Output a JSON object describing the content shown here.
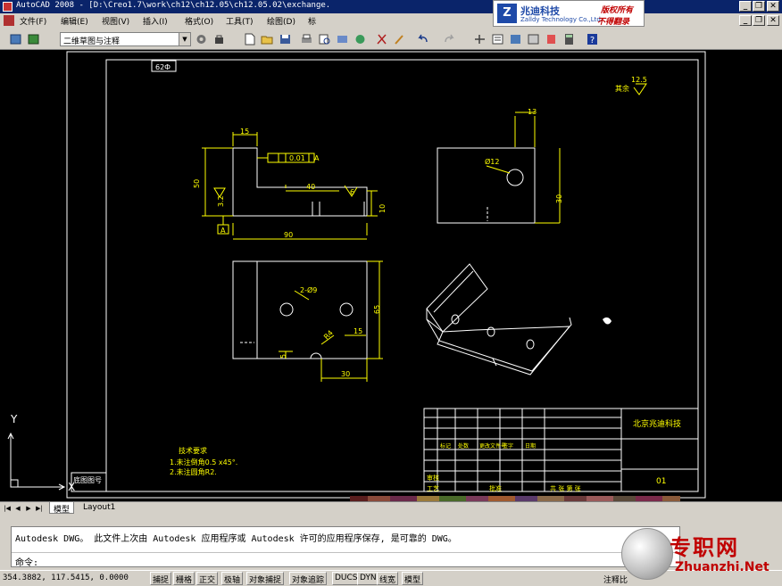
{
  "window": {
    "title": "AutoCAD 2008 - [D:\\Creo1.7\\work\\ch12\\ch12.05\\ch12.05.02\\exchange.",
    "min": "_",
    "restore": "❐",
    "close": "✕",
    "doc_min": "_",
    "doc_restore": "❐",
    "doc_close": "✕"
  },
  "logo": {
    "mark": "Z",
    "company_cn": "兆迪科技",
    "company_en": "Zalldy Technology Co.,Ltd.",
    "copyright_1": "版权所有",
    "copyright_2": "不得翻录"
  },
  "menu": [
    "文件(F)",
    "编辑(E)",
    "视图(V)",
    "插入(I)",
    "格式(O)",
    "工具(T)",
    "绘图(D)",
    "标"
  ],
  "workspace": {
    "value": "二维草图与注释"
  },
  "drawing": {
    "corner_tag": "62Ф",
    "roughness_other": "其余",
    "roughness_other_value": "12.5",
    "dims": {
      "d15": "15",
      "d50": "50",
      "d40": "40",
      "d6": "6",
      "d10": "10",
      "d90": "90",
      "d32": "3.2",
      "datum": "A",
      "tol": "0.01",
      "tol_ref": "A",
      "d13": "13",
      "dia12": "Ø12",
      "d30a": "30",
      "holes": "2-Ø9",
      "d65": "65",
      "r4": "R4",
      "d15b": "15",
      "d5": "5",
      "d30b": "30"
    },
    "tech_title": "技术要求",
    "tech_1": "1.未注倒角0.5 x45°.",
    "tech_2": "2.未注圆角R2.",
    "title_block": {
      "company": "北京兆迪科技",
      "sheet": "01",
      "row_labels": [
        "审核",
        "工艺"
      ],
      "approve": "批准",
      "sheet_info": "共  张 第  张",
      "header_cells": [
        "标记",
        "处数",
        "更改文件号",
        "签字",
        "日期"
      ]
    },
    "ref_label": "底图图号",
    "ucs_x": "X",
    "ucs_y": "Y"
  },
  "tabs": {
    "nav": [
      "|◀",
      "◀",
      "▶",
      "▶|"
    ],
    "items": [
      "模型",
      "Layout1"
    ],
    "active": "模型"
  },
  "command": {
    "history": "Autodesk DWG。  此文件上次由 Autodesk 应用程序或 Autodesk 许可的应用程序保存, 是可靠的 DWG。",
    "prompt": "命令:"
  },
  "status": {
    "coords": "354.3882, 117.5415, 0.0000",
    "toggles": [
      "捕捉",
      "栅格",
      "正交",
      "极轴",
      "对象捕捉",
      "对象追踪",
      "DUCS",
      "DYN",
      "线宽",
      "模型"
    ],
    "annotation_scale": "注释比"
  },
  "watermark": {
    "text": "专职网",
    "url": "Zhuanzhi.Net"
  },
  "colors": {
    "titlebar": "#0a246a",
    "canvas": "#000000",
    "drawing_line": "#ffffff",
    "dim_line": "#ffff00",
    "chrome": "#d4d0c8"
  }
}
